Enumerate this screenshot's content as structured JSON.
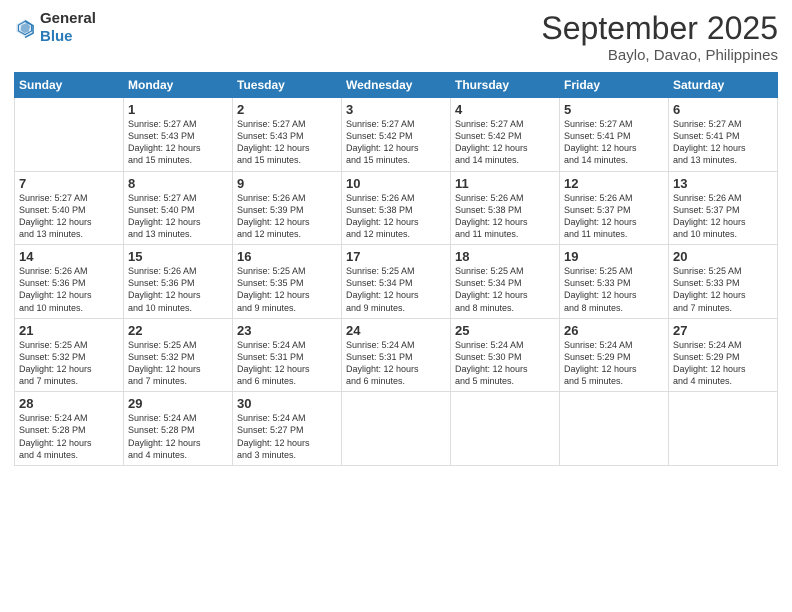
{
  "logo": {
    "general": "General",
    "blue": "Blue"
  },
  "title": "September 2025",
  "location": "Baylo, Davao, Philippines",
  "days_of_week": [
    "Sunday",
    "Monday",
    "Tuesday",
    "Wednesday",
    "Thursday",
    "Friday",
    "Saturday"
  ],
  "weeks": [
    [
      {
        "day": "",
        "info": ""
      },
      {
        "day": "1",
        "info": "Sunrise: 5:27 AM\nSunset: 5:43 PM\nDaylight: 12 hours\nand 15 minutes."
      },
      {
        "day": "2",
        "info": "Sunrise: 5:27 AM\nSunset: 5:43 PM\nDaylight: 12 hours\nand 15 minutes."
      },
      {
        "day": "3",
        "info": "Sunrise: 5:27 AM\nSunset: 5:42 PM\nDaylight: 12 hours\nand 15 minutes."
      },
      {
        "day": "4",
        "info": "Sunrise: 5:27 AM\nSunset: 5:42 PM\nDaylight: 12 hours\nand 14 minutes."
      },
      {
        "day": "5",
        "info": "Sunrise: 5:27 AM\nSunset: 5:41 PM\nDaylight: 12 hours\nand 14 minutes."
      },
      {
        "day": "6",
        "info": "Sunrise: 5:27 AM\nSunset: 5:41 PM\nDaylight: 12 hours\nand 13 minutes."
      }
    ],
    [
      {
        "day": "7",
        "info": "Sunrise: 5:27 AM\nSunset: 5:40 PM\nDaylight: 12 hours\nand 13 minutes."
      },
      {
        "day": "8",
        "info": "Sunrise: 5:27 AM\nSunset: 5:40 PM\nDaylight: 12 hours\nand 13 minutes."
      },
      {
        "day": "9",
        "info": "Sunrise: 5:26 AM\nSunset: 5:39 PM\nDaylight: 12 hours\nand 12 minutes."
      },
      {
        "day": "10",
        "info": "Sunrise: 5:26 AM\nSunset: 5:38 PM\nDaylight: 12 hours\nand 12 minutes."
      },
      {
        "day": "11",
        "info": "Sunrise: 5:26 AM\nSunset: 5:38 PM\nDaylight: 12 hours\nand 11 minutes."
      },
      {
        "day": "12",
        "info": "Sunrise: 5:26 AM\nSunset: 5:37 PM\nDaylight: 12 hours\nand 11 minutes."
      },
      {
        "day": "13",
        "info": "Sunrise: 5:26 AM\nSunset: 5:37 PM\nDaylight: 12 hours\nand 10 minutes."
      }
    ],
    [
      {
        "day": "14",
        "info": "Sunrise: 5:26 AM\nSunset: 5:36 PM\nDaylight: 12 hours\nand 10 minutes."
      },
      {
        "day": "15",
        "info": "Sunrise: 5:26 AM\nSunset: 5:36 PM\nDaylight: 12 hours\nand 10 minutes."
      },
      {
        "day": "16",
        "info": "Sunrise: 5:25 AM\nSunset: 5:35 PM\nDaylight: 12 hours\nand 9 minutes."
      },
      {
        "day": "17",
        "info": "Sunrise: 5:25 AM\nSunset: 5:34 PM\nDaylight: 12 hours\nand 9 minutes."
      },
      {
        "day": "18",
        "info": "Sunrise: 5:25 AM\nSunset: 5:34 PM\nDaylight: 12 hours\nand 8 minutes."
      },
      {
        "day": "19",
        "info": "Sunrise: 5:25 AM\nSunset: 5:33 PM\nDaylight: 12 hours\nand 8 minutes."
      },
      {
        "day": "20",
        "info": "Sunrise: 5:25 AM\nSunset: 5:33 PM\nDaylight: 12 hours\nand 7 minutes."
      }
    ],
    [
      {
        "day": "21",
        "info": "Sunrise: 5:25 AM\nSunset: 5:32 PM\nDaylight: 12 hours\nand 7 minutes."
      },
      {
        "day": "22",
        "info": "Sunrise: 5:25 AM\nSunset: 5:32 PM\nDaylight: 12 hours\nand 7 minutes."
      },
      {
        "day": "23",
        "info": "Sunrise: 5:24 AM\nSunset: 5:31 PM\nDaylight: 12 hours\nand 6 minutes."
      },
      {
        "day": "24",
        "info": "Sunrise: 5:24 AM\nSunset: 5:31 PM\nDaylight: 12 hours\nand 6 minutes."
      },
      {
        "day": "25",
        "info": "Sunrise: 5:24 AM\nSunset: 5:30 PM\nDaylight: 12 hours\nand 5 minutes."
      },
      {
        "day": "26",
        "info": "Sunrise: 5:24 AM\nSunset: 5:29 PM\nDaylight: 12 hours\nand 5 minutes."
      },
      {
        "day": "27",
        "info": "Sunrise: 5:24 AM\nSunset: 5:29 PM\nDaylight: 12 hours\nand 4 minutes."
      }
    ],
    [
      {
        "day": "28",
        "info": "Sunrise: 5:24 AM\nSunset: 5:28 PM\nDaylight: 12 hours\nand 4 minutes."
      },
      {
        "day": "29",
        "info": "Sunrise: 5:24 AM\nSunset: 5:28 PM\nDaylight: 12 hours\nand 4 minutes."
      },
      {
        "day": "30",
        "info": "Sunrise: 5:24 AM\nSunset: 5:27 PM\nDaylight: 12 hours\nand 3 minutes."
      },
      {
        "day": "",
        "info": ""
      },
      {
        "day": "",
        "info": ""
      },
      {
        "day": "",
        "info": ""
      },
      {
        "day": "",
        "info": ""
      }
    ]
  ]
}
